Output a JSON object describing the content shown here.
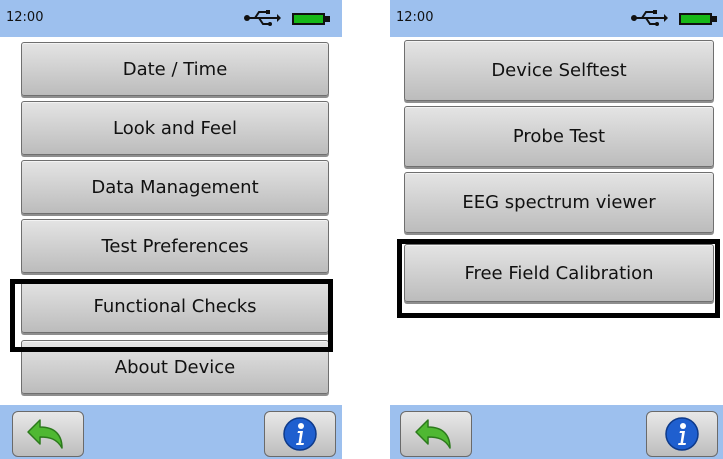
{
  "left_screen": {
    "status": {
      "time": "12:00"
    },
    "menu_items": [
      "Date / Time",
      "Look and Feel",
      "Data Management",
      "Test Preferences",
      "Functional Checks",
      "About Device"
    ],
    "highlighted_item": "Functional Checks"
  },
  "right_screen": {
    "status": {
      "time": "12:00"
    },
    "menu_items": [
      "Device Selftest",
      "Probe Test",
      "EEG spectrum viewer",
      "Free Field Calibration"
    ],
    "highlighted_item": "Free Field Calibration"
  },
  "icons": {
    "status": [
      "usb-icon",
      "battery-icon"
    ],
    "bottom": [
      "back-arrow-icon",
      "info-icon"
    ]
  },
  "colors": {
    "bar_blue": "#9dc0ee",
    "battery_green": "#17b817",
    "back_arrow_green": "#4fb832",
    "info_blue": "#1f5fcf",
    "highlight_border": "#000000"
  }
}
